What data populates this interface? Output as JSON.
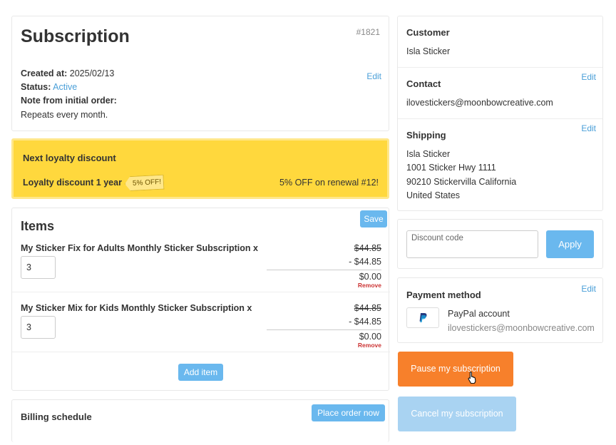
{
  "subscription": {
    "title": "Subscription",
    "number": "#1821",
    "created_label": "Created at:",
    "created_value": "2025/02/13",
    "status_label": "Status:",
    "status_value": "Active",
    "note_label": "Note from initial order:",
    "note_value": "Repeats every month.",
    "edit_label": "Edit"
  },
  "loyalty": {
    "title": "Next loyalty discount",
    "discount_name": "Loyalty discount 1 year",
    "tag": "5% OFF!",
    "renewal_text": "5% OFF on renewal #12!"
  },
  "items": {
    "title": "Items",
    "save_label": "Save",
    "add_item_label": "Add item",
    "rows": [
      {
        "name": "My Sticker Fix for Adults Monthly Sticker Subscription x",
        "quantity": "3",
        "original_price": "$44.85",
        "discount": "- $44.85",
        "final_price": "$0.00",
        "remove_label": "Remove"
      },
      {
        "name": "My Sticker Mix for Kids Monthly Sticker Subscription x",
        "quantity": "3",
        "original_price": "$44.85",
        "discount": "- $44.85",
        "final_price": "$0.00",
        "remove_label": "Remove"
      }
    ]
  },
  "billing": {
    "title": "Billing schedule",
    "place_order_label": "Place order now"
  },
  "customer": {
    "title": "Customer",
    "name": "Isla Sticker"
  },
  "contact": {
    "title": "Contact",
    "edit_label": "Edit",
    "email": "ilovestickers@moonbowcreative.com"
  },
  "shipping": {
    "title": "Shipping",
    "edit_label": "Edit",
    "lines": [
      "Isla Sticker",
      "1001 Sticker Hwy 1111",
      "90210 Stickervilla California",
      "United States"
    ]
  },
  "discount": {
    "placeholder": "Discount code",
    "apply_label": "Apply"
  },
  "payment": {
    "title": "Payment method",
    "edit_label": "Edit",
    "account": "PayPal account",
    "email": "ilovestickers@moonbowcreative.com",
    "icon": "paypal-icon"
  },
  "actions": {
    "pause_label": "Pause my subscription",
    "cancel_label": "Cancel my subscription"
  },
  "colors": {
    "accent": "#4a9fd8",
    "button": "#6ab8ee",
    "loyalty": "#ffd83d",
    "pause": "#f7802b",
    "cancel": "#a9d3f2",
    "remove": "#cc3333"
  }
}
